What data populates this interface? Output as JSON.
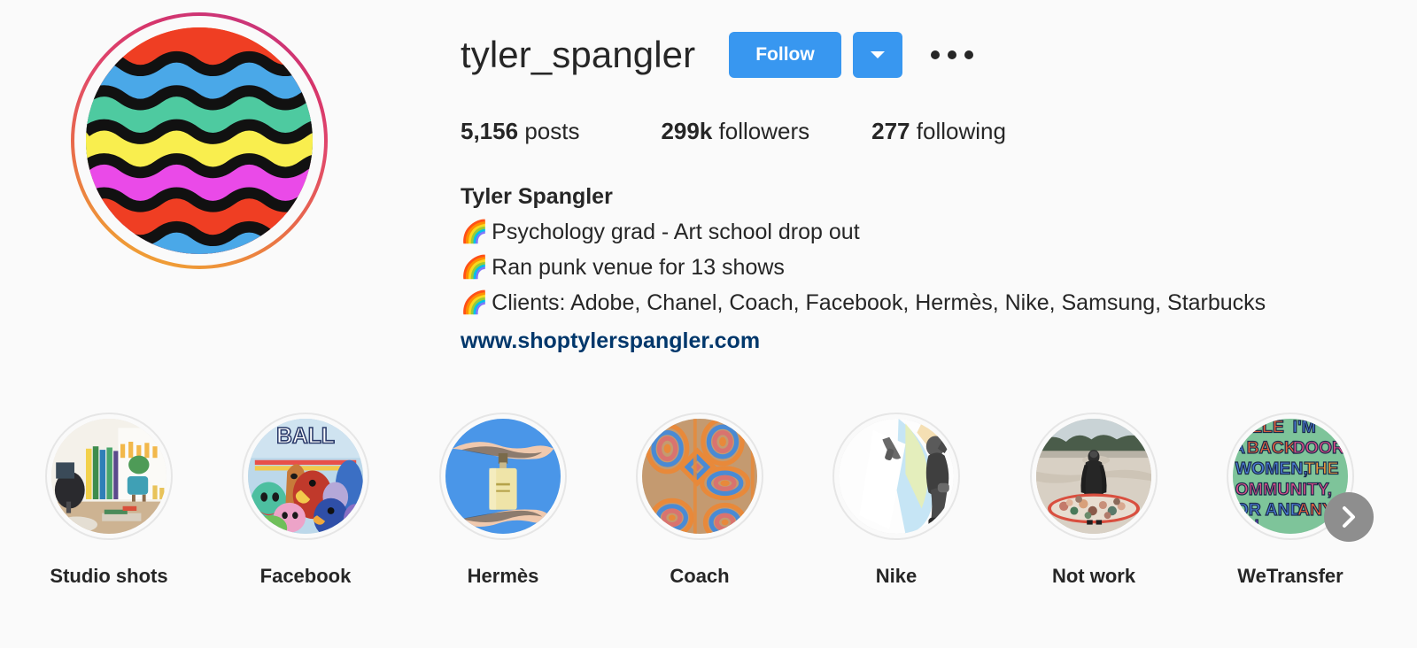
{
  "profile": {
    "username": "tyler_spangler",
    "full_name": "Tyler Spangler",
    "avatar_alt": "rainbow-wave-stripes-avatar"
  },
  "actions": {
    "follow_label": "Follow",
    "dropdown_icon": "chevron-down-icon",
    "more_icon": "more-options-icon"
  },
  "stats": {
    "posts_count": "5,156",
    "posts_label": "posts",
    "followers_count": "299k",
    "followers_label": "followers",
    "following_count": "277",
    "following_label": "following"
  },
  "bio": {
    "line1_emoji": "🌈",
    "line1": "Psychology grad - Art school drop out",
    "line2_emoji": "🌈",
    "line2": "Ran punk venue for 13 shows",
    "line3_emoji": "🌈",
    "line3": "Clients: Adobe, Chanel, Coach, Facebook, Hermès, Nike, Samsung, Starbucks",
    "website": "www.shoptylerspangler.com"
  },
  "highlights": [
    {
      "label": "Studio shots",
      "thumb": "studio-interior-surfboards"
    },
    {
      "label": "Facebook",
      "thumb": "animal-collage-ball"
    },
    {
      "label": "Hermès",
      "thumb": "perfume-bottle-hands-blue"
    },
    {
      "label": "Coach",
      "thumb": "concentric-oval-pattern-tan"
    },
    {
      "label": "Nike",
      "thumb": "athlete-watercolor-white"
    },
    {
      "label": "Not work",
      "thumb": "beach-surfboard-person"
    },
    {
      "label": "WeTransfer",
      "thumb": "green-block-typography"
    }
  ],
  "carousel": {
    "next_icon": "chevron-right-icon"
  },
  "colors": {
    "accent_blue": "#3897f0",
    "link_navy": "#00376b",
    "text_primary": "#262626",
    "background": "#fafafa",
    "ring_start": "#c13584",
    "ring_end": "#f2a93b"
  }
}
